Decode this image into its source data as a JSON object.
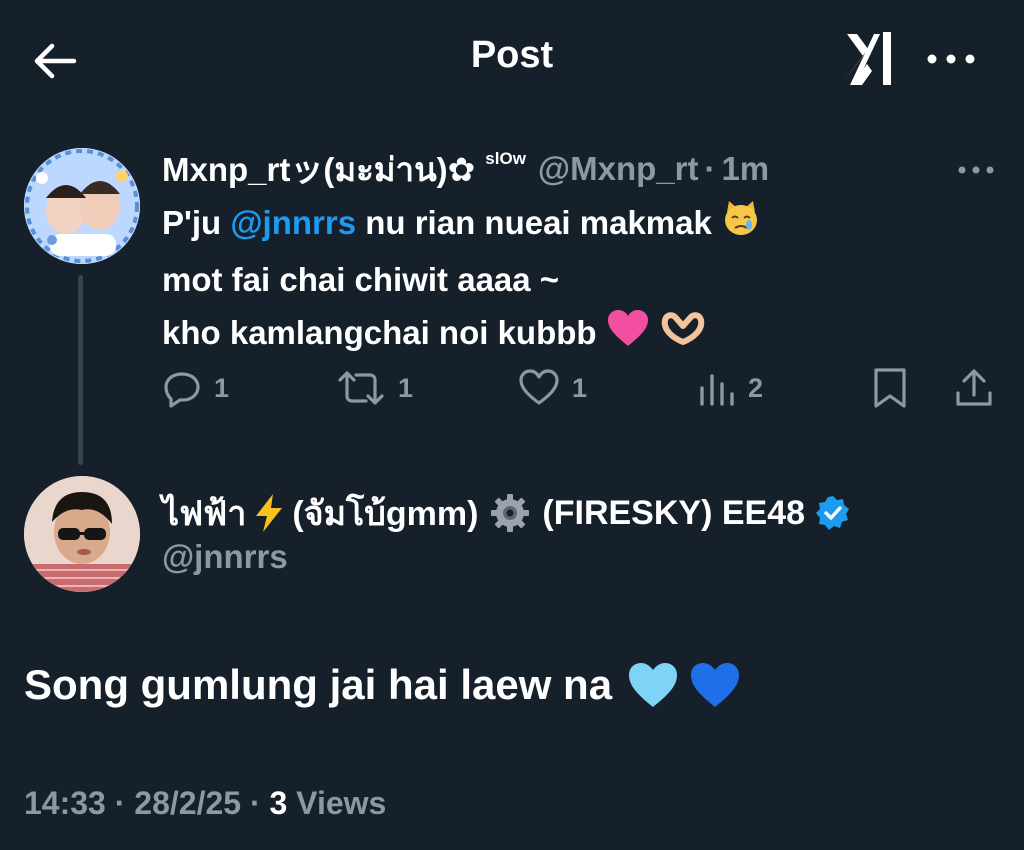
{
  "header": {
    "title": "Post",
    "back_icon": "back-arrow-icon",
    "grok_icon": "grok-logo-icon",
    "more_icon": "more-horizontal-icon"
  },
  "parent_post": {
    "display_name": "Mxnp_rtッ(มะม่าน)✿",
    "name_suffix": "slOw",
    "handle": "@Mxnp_rt",
    "time": "1m",
    "body": {
      "line1_prefix": "P'ju ",
      "line1_mention": "@jnnrrs",
      "line1_suffix": " nu rian nueai makmak",
      "line2": "mot fai chai chiwit aaaa ~",
      "line3": "kho kamlangchai noi kubbb"
    },
    "actions": {
      "replies": "1",
      "reposts": "1",
      "likes": "1",
      "views": "2"
    }
  },
  "reply_author": {
    "display_name_part1": "ไฟฟ้า",
    "display_name_part2": "(จัมโบ้gmm)",
    "display_name_part3": "(FIRESKY) EE48",
    "handle": "@jnnrrs",
    "verified_color": "#1d9bf0"
  },
  "reply_post": {
    "text": "Song gumlung jai hai laew na"
  },
  "meta": {
    "time": "14:33",
    "date": "28/2/25",
    "views_count": "3",
    "views_label": "Views"
  },
  "colors": {
    "background": "#15202b",
    "muted": "#8b98a5",
    "accent": "#1d9bf0"
  }
}
